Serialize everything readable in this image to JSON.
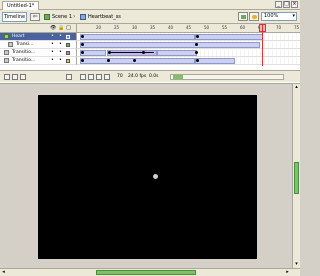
{
  "window": {
    "doc_tab": "Untitled-1*",
    "controls": [
      "_",
      "□",
      "×"
    ]
  },
  "toolbar": {
    "timeline_label": "Timeline",
    "back_glyph": "⇦",
    "scene_label": "Scene 1",
    "separator": "›",
    "symbol_label": "Heartbeat_ss",
    "zoom_value": "100%"
  },
  "timeline": {
    "header_icons": [
      "👁",
      "🔒",
      "□"
    ],
    "ruler": [
      "20",
      "25",
      "30",
      "35",
      "40",
      "45",
      "50",
      "55",
      "60",
      "65",
      "70",
      "75"
    ],
    "layers": [
      {
        "name": "Heart",
        "selected": true
      },
      {
        "name": "Transi...",
        "selected": false
      },
      {
        "name": "Transitio...",
        "selected": false
      },
      {
        "name": "Transitio...",
        "selected": false
      }
    ],
    "footer": {
      "frame": "70",
      "fps": "24.0 fps",
      "time": "0.0s"
    }
  },
  "stage": {
    "background_color": "#000000"
  },
  "colors": {
    "accent_green": "#7fc16a",
    "selected_layer": "#4a62a0",
    "playhead": "#e03030"
  }
}
